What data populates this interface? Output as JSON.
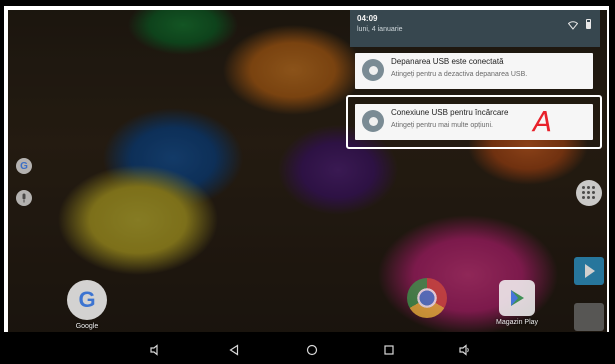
{
  "status": {
    "time": "04:09",
    "date": "luni, 4 ianuarie"
  },
  "notifications": [
    {
      "title": "Depanarea USB este conectată",
      "text": "Atingeți pentru a dezactiva depanarea USB."
    },
    {
      "title": "Conexiune USB pentru încărcare",
      "text": "Atingeți pentru mai multe opțiuni."
    }
  ],
  "annotation": {
    "marker": "A",
    "color": "#e8212a"
  },
  "apps": {
    "google": "Google",
    "store": "Magazin Play"
  },
  "colors": {
    "shade_header": "#37474f",
    "card": "#f6f6f6",
    "notif_icon": "#7a8b94"
  }
}
